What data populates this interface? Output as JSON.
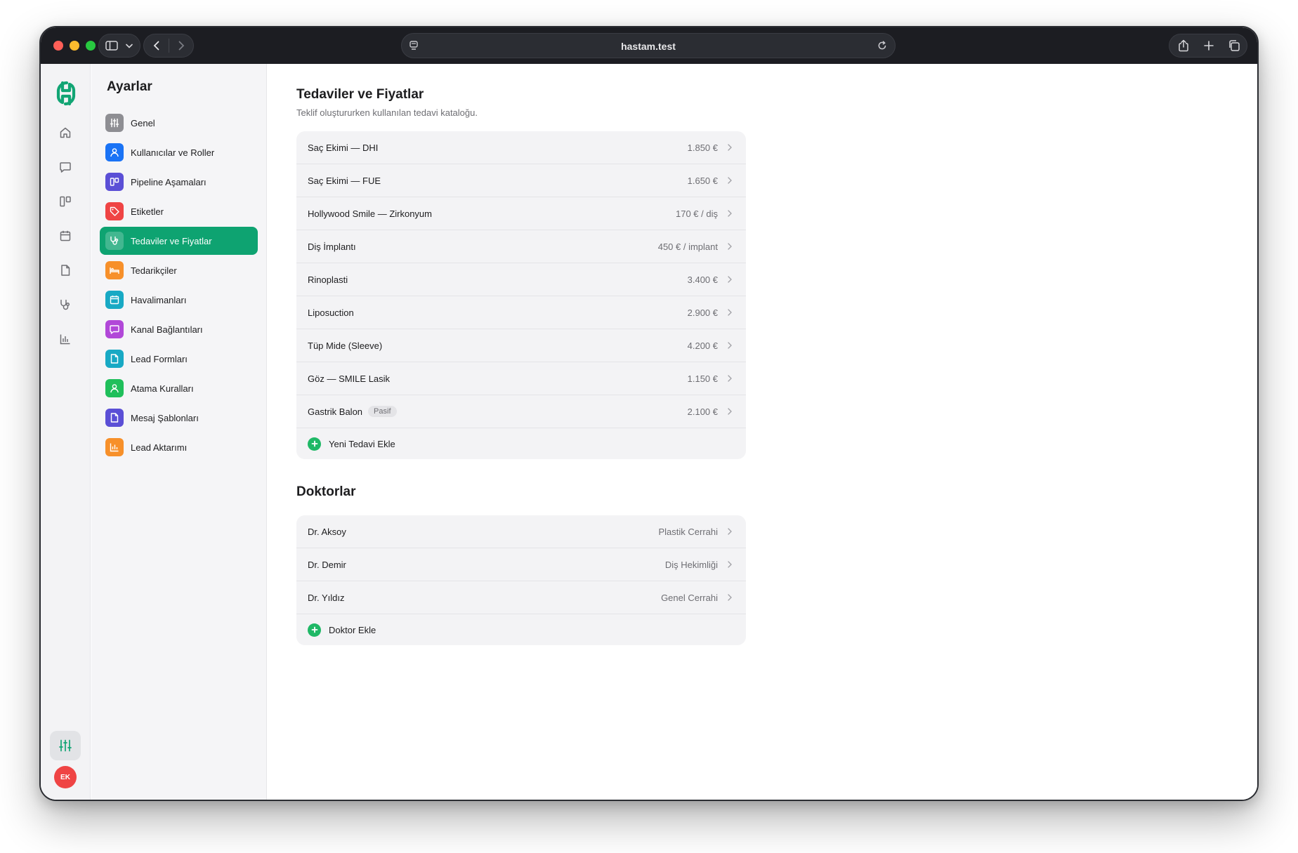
{
  "browser": {
    "url": "hastam.test"
  },
  "rail": {
    "icons": [
      "home-icon",
      "chat-icon",
      "pipeline-icon",
      "calendar-icon",
      "document-icon",
      "stethoscope-icon",
      "chart-icon"
    ],
    "settings_icon": "sliders-icon",
    "avatar_initials": "EK"
  },
  "settings_nav": {
    "title": "Ayarlar",
    "items": [
      {
        "label": "Genel",
        "icon": "sliders-icon",
        "color": "#8e8e93"
      },
      {
        "label": "Kullanıcılar ve Roller",
        "icon": "user-icon",
        "color": "#1a73f5"
      },
      {
        "label": "Pipeline Aşamaları",
        "icon": "pipeline-icon",
        "color": "#5b4fd6"
      },
      {
        "label": "Etiketler",
        "icon": "tag-icon",
        "color": "#ef4444"
      },
      {
        "label": "Tedaviler ve Fiyatlar",
        "icon": "stethoscope-icon",
        "color": "#0ea371",
        "active": true
      },
      {
        "label": "Tedarikçiler",
        "icon": "bed-icon",
        "color": "#f7902a"
      },
      {
        "label": "Havalimanları",
        "icon": "calendar-icon",
        "color": "#18a9c4"
      },
      {
        "label": "Kanal Bağlantıları",
        "icon": "chat-icon",
        "color": "#b148d8"
      },
      {
        "label": "Lead Formları",
        "icon": "document-icon",
        "color": "#18a9c4"
      },
      {
        "label": "Atama Kuralları",
        "icon": "user-icon",
        "color": "#20bf5b"
      },
      {
        "label": "Mesaj Şablonları",
        "icon": "document-icon",
        "color": "#5b4fd6"
      },
      {
        "label": "Lead Aktarımı",
        "icon": "chart-icon",
        "color": "#f7902a"
      }
    ]
  },
  "treatments": {
    "title": "Tedaviler ve Fiyatlar",
    "subtitle": "Teklif oluştururken kullanılan tedavi kataloğu.",
    "rows": [
      {
        "name": "Saç Ekimi — DHI",
        "price": "1.850 €"
      },
      {
        "name": "Saç Ekimi — FUE",
        "price": "1.650 €"
      },
      {
        "name": "Hollywood Smile — Zirkonyum",
        "price": "170 € / diş"
      },
      {
        "name": "Diş İmplantı",
        "price": "450 € / implant"
      },
      {
        "name": "Rinoplasti",
        "price": "3.400 €"
      },
      {
        "name": "Liposuction",
        "price": "2.900 €"
      },
      {
        "name": "Tüp Mide (Sleeve)",
        "price": "4.200 €"
      },
      {
        "name": "Göz — SMILE Lasik",
        "price": "1.150 €"
      },
      {
        "name": "Gastrik Balon",
        "price": "2.100 €",
        "badge": "Pasif"
      }
    ],
    "add_label": "Yeni Tedavi Ekle"
  },
  "doctors": {
    "title": "Doktorlar",
    "rows": [
      {
        "name": "Dr. Aksoy",
        "specialty": "Plastik Cerrahi"
      },
      {
        "name": "Dr. Demir",
        "specialty": "Diş Hekimliği"
      },
      {
        "name": "Dr. Yıldız",
        "specialty": "Genel Cerrahi"
      }
    ],
    "add_label": "Doktor Ekle"
  }
}
